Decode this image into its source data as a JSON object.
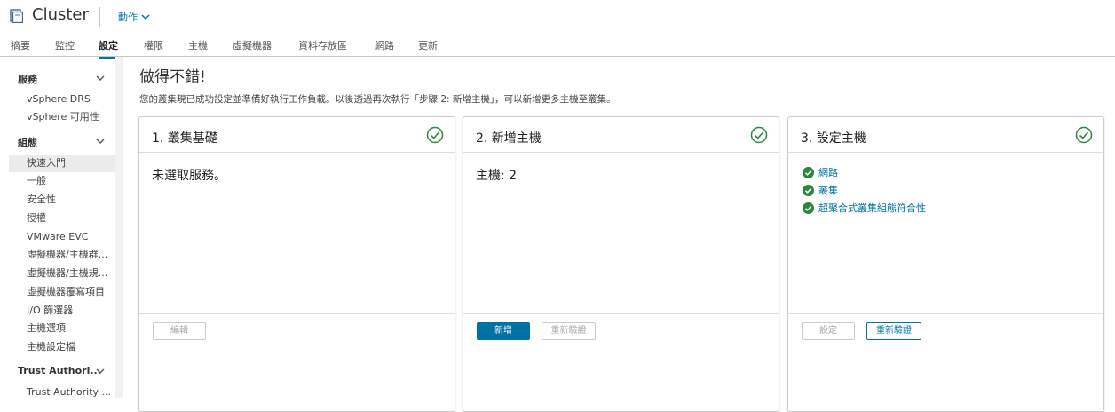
{
  "header": {
    "title": "Cluster",
    "actions_label": "動作",
    "icon": "cluster-icon"
  },
  "tabs": [
    {
      "label": "摘要"
    },
    {
      "label": "監控"
    },
    {
      "label": "設定",
      "active": true
    },
    {
      "label": "權限"
    },
    {
      "label": "主機"
    },
    {
      "label": "虛擬機器"
    },
    {
      "label": "資料存放區"
    },
    {
      "label": "網路"
    },
    {
      "label": "更新"
    }
  ],
  "sidebar": {
    "groups": [
      {
        "label": "服務",
        "items": [
          "vSphere DRS",
          "vSphere 可用性"
        ]
      },
      {
        "label": "組態",
        "items": [
          "快速入門",
          "一般",
          "安全性",
          "授權",
          "VMware EVC",
          "虛擬機器/主機群...",
          "虛擬機器/主機規...",
          "虛擬機器覆寫項目",
          "I/O 篩選器",
          "主機選項",
          "主機設定檔"
        ]
      },
      {
        "label": "Trust Authori...",
        "items": [
          "Trust Authority ..."
        ]
      }
    ],
    "selected": "快速入門"
  },
  "main": {
    "heading": "做得不錯!",
    "description": "您的叢集現已成功設定並準備好執行工作負載。以後透過再次執行「步驟 2: 新增主機」，可以新增更多主機至叢集。",
    "cards": [
      {
        "title": "1. 叢集基礎",
        "body": "未選取服務。",
        "buttons": [
          {
            "label": "編輯",
            "state": "disabled"
          }
        ]
      },
      {
        "title": "2. 新增主機",
        "body": "主機: 2",
        "buttons": [
          {
            "label": "新增",
            "state": "primary"
          },
          {
            "label": "重新驗證",
            "state": "disabled"
          }
        ]
      },
      {
        "title": "3. 設定主機",
        "links": [
          "網路",
          "叢集",
          "超聚合式叢集組態符合性"
        ],
        "buttons": [
          {
            "label": "設定",
            "state": "disabled"
          },
          {
            "label": "重新驗證",
            "state": "outline"
          }
        ]
      }
    ]
  },
  "colors": {
    "accent": "#0072a3",
    "success": "#2e8540"
  }
}
